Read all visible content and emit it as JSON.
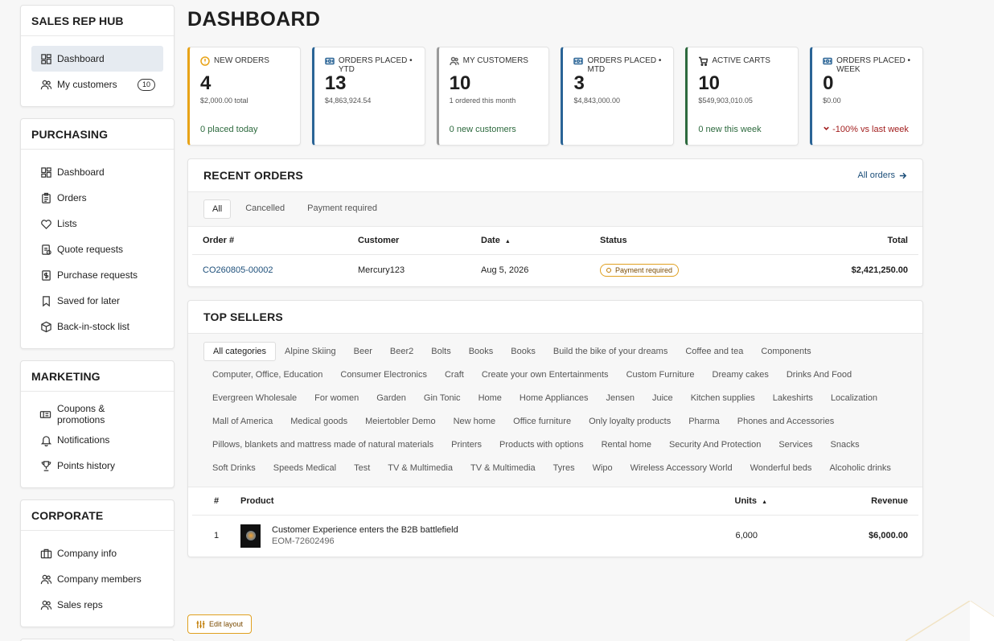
{
  "sidebar": {
    "sections": [
      {
        "title": "SALES REP HUB",
        "items": [
          {
            "label": "Dashboard",
            "icon": "grid-icon",
            "active": true
          },
          {
            "label": "My customers",
            "icon": "users-icon",
            "badge": "10"
          }
        ]
      },
      {
        "title": "PURCHASING",
        "items": [
          {
            "label": "Dashboard",
            "icon": "grid-icon"
          },
          {
            "label": "Orders",
            "icon": "clipboard-icon"
          },
          {
            "label": "Lists",
            "icon": "heart-icon"
          },
          {
            "label": "Quote requests",
            "icon": "quote-icon"
          },
          {
            "label": "Purchase requests",
            "icon": "dollar-doc-icon"
          },
          {
            "label": "Saved for later",
            "icon": "bookmark-icon"
          },
          {
            "label": "Back-in-stock list",
            "icon": "box-icon"
          }
        ]
      },
      {
        "title": "MARKETING",
        "items": [
          {
            "label": "Coupons & promotions",
            "icon": "ticket-icon"
          },
          {
            "label": "Notifications",
            "icon": "bell-icon"
          },
          {
            "label": "Points history",
            "icon": "trophy-icon"
          }
        ]
      },
      {
        "title": "CORPORATE",
        "items": [
          {
            "label": "Company info",
            "icon": "briefcase-icon"
          },
          {
            "label": "Company members",
            "icon": "users-icon"
          },
          {
            "label": "Sales reps",
            "icon": "users-icon"
          }
        ]
      }
    ]
  },
  "page": {
    "title": "DASHBOARD"
  },
  "stats": [
    {
      "label": "NEW ORDERS",
      "value": "4",
      "sub": "$2,000.00 total",
      "foot": "0 placed today",
      "color": "#e8a317",
      "foot_color": "#2d6a3e",
      "icon": "alert-circle-icon"
    },
    {
      "label": "ORDERS PLACED • YTD",
      "value": "13",
      "sub": "$4,863,924.54",
      "foot": "",
      "color": "#2a6496",
      "foot_color": "#2d6a3e",
      "icon": "money-icon"
    },
    {
      "label": "MY CUSTOMERS",
      "value": "10",
      "sub": "1 ordered this month",
      "foot": "0 new customers",
      "color": "#9a9a9a",
      "foot_color": "#2d6a3e",
      "icon": "users-icon"
    },
    {
      "label": "ORDERS PLACED • MTD",
      "value": "3",
      "sub": "$4,843,000.00",
      "foot": "",
      "color": "#2a6496",
      "foot_color": "#2d6a3e",
      "icon": "money-icon"
    },
    {
      "label": "ACTIVE CARTS",
      "value": "10",
      "sub": "$549,903,010.05",
      "foot": "0 new this week",
      "color": "#2d6a3e",
      "foot_color": "#2d6a3e",
      "icon": "cart-icon"
    },
    {
      "label": "ORDERS PLACED • WEEK",
      "value": "0",
      "sub": "$0.00",
      "foot": "-100% vs last week",
      "color": "#2a6496",
      "foot_color": "#a32020",
      "icon": "money-icon",
      "foot_icon": "chevron-down-icon"
    }
  ],
  "recent_orders": {
    "title": "RECENT ORDERS",
    "all_link": "All orders",
    "tabs": [
      "All",
      "Cancelled",
      "Payment required"
    ],
    "columns": [
      "Order #",
      "Customer",
      "Date",
      "Status",
      "Total"
    ],
    "rows": [
      {
        "order": "CO260805-00002",
        "customer": "Mercury123",
        "date": "Aug 5, 2026",
        "status": "Payment required",
        "total": "$2,421,250.00"
      }
    ]
  },
  "top_sellers": {
    "title": "TOP SELLERS",
    "categories": [
      "All categories",
      "Alpine Skiing",
      "Beer",
      "Beer2",
      "Bolts",
      "Books",
      "Books",
      "Build the bike of your dreams",
      "Coffee and tea",
      "Components",
      "Computer, Office, Education",
      "Consumer Electronics",
      "Craft",
      "Create your own Entertainments",
      "Custom Furniture",
      "Dreamy cakes",
      "Drinks And Food",
      "Evergreen Wholesale",
      "For women",
      "Garden",
      "Gin Tonic",
      "Home",
      "Home Appliances",
      "Jensen",
      "Juice",
      "Kitchen supplies",
      "Lakeshirts",
      "Localization",
      "Mall of America",
      "Medical goods",
      "Meiertobler Demo",
      "New home",
      "Office furniture",
      "Only loyalty products",
      "Pharma",
      "Phones and Accessories",
      "Pillows, blankets and mattress made of natural materials",
      "Printers",
      "Products with options",
      "Rental home",
      "Security And Protection",
      "Services",
      "Snacks",
      "Soft Drinks",
      "Speeds Medical",
      "Test",
      "TV & Multimedia",
      "TV & Multimedia",
      "Tyres",
      "Wipo",
      "Wireless Accessory World",
      "Wonderful beds",
      "Alcoholic drinks"
    ],
    "columns": [
      "#",
      "Product",
      "Units",
      "Revenue"
    ],
    "rows": [
      {
        "rank": "1",
        "name": "Customer Experience enters the B2B battlefield",
        "sku": "EOM-72602496",
        "units": "6,000",
        "revenue": "$6,000.00"
      }
    ]
  },
  "edit_layout": "Edit layout"
}
